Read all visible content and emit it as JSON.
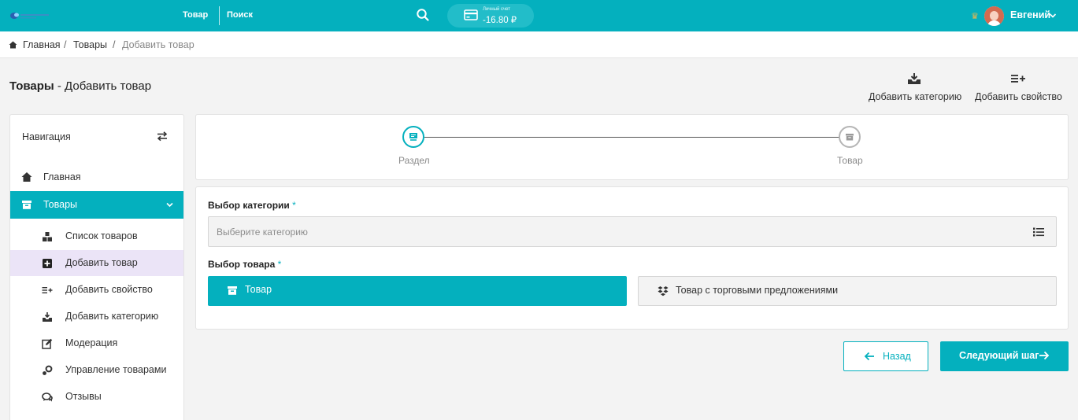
{
  "topbar": {
    "nav_product": "Товар",
    "nav_search": "Поиск",
    "account_label": "Личный счет",
    "account_balance": "-16.80 ₽",
    "user_name": "Евгений"
  },
  "breadcrumb": {
    "home": "Главная",
    "products": "Товары",
    "current": "Добавить товар",
    "separator": "/"
  },
  "page": {
    "title_bold": "Товары",
    "title_rest": " - Добавить товар"
  },
  "header_actions": {
    "add_category": "Добавить категорию",
    "add_property": "Добавить свойство"
  },
  "sidebar": {
    "title": "Навигация",
    "home": "Главная",
    "products": "Товары",
    "sub_items": [
      {
        "label": "Список товаров",
        "icon": "boxes-icon"
      },
      {
        "label": "Добавить товар",
        "icon": "plus-square-icon"
      },
      {
        "label": "Добавить свойство",
        "icon": "list-plus-icon"
      },
      {
        "label": "Добавить категорию",
        "icon": "inbox-download-icon"
      },
      {
        "label": "Модерация",
        "icon": "edit-icon"
      },
      {
        "label": "Управление товарами",
        "icon": "gears-icon"
      },
      {
        "label": "Отзывы",
        "icon": "comments-icon"
      }
    ]
  },
  "stepper": {
    "step1": "Раздел",
    "step2": "Товар",
    "active_step": 1
  },
  "form": {
    "category_label": "Выбор категории",
    "required_mark": "*",
    "category_placeholder": "Выберите категорию",
    "product_label": "Выбор товара",
    "choice_product": "Товар",
    "choice_offers": "Товар с торговыми предложениями"
  },
  "actions": {
    "back": "Назад",
    "next": "Следующий шаг"
  },
  "colors": {
    "accent": "#04b0be",
    "selected_bg": "#ebe4f7",
    "page_bg": "#f3f3f3"
  }
}
